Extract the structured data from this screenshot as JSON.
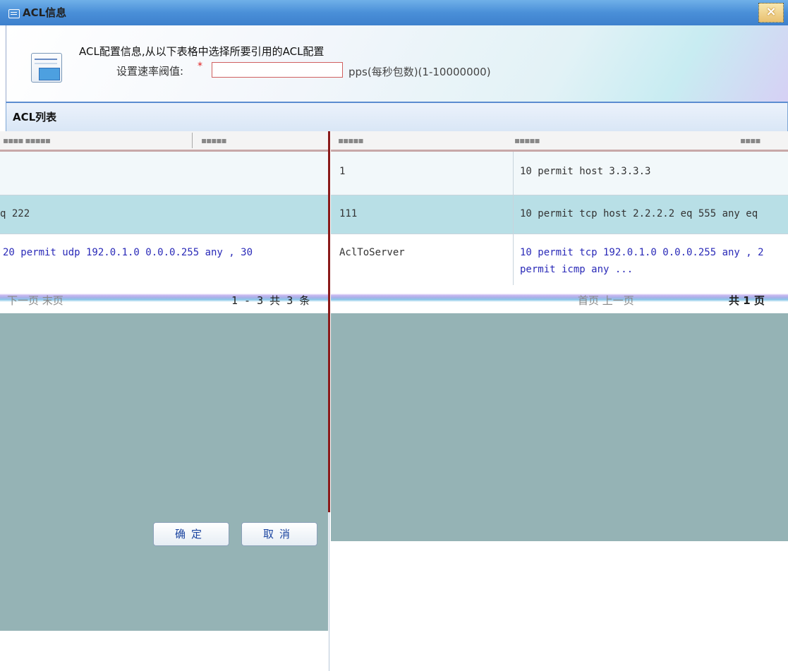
{
  "dialog": {
    "title": "ACL信息",
    "close_label": "×"
  },
  "header": {
    "info_text": "ACL配置信息,从以下表格中选择所要引用的ACL配置",
    "rate_label": "设置速率阀值:",
    "required_mark": "*",
    "rate_value": "",
    "rate_unit": "pps(每秒包数)(1-10000000)"
  },
  "acl_list": {
    "title": "ACL列表"
  },
  "left_table": {
    "header_fragments": [
      "▪▪▪▪ ▪▪▪▪▪",
      "▪▪▪▪▪"
    ],
    "rows": [
      {
        "text": ""
      },
      {
        "text": "q 222"
      },
      {
        "text": "20 permit udp 192.0.1.0 0.0.0.255 any , 30"
      }
    ],
    "pager": {
      "nav_text": "下一页 末页",
      "range_text": "1 - 3  共 3 条"
    },
    "buttons": {
      "ok_label": "确定",
      "cancel_label": "取消"
    }
  },
  "right_table": {
    "header_fragments": [
      "▪▪▪▪▪",
      "▪▪▪▪▪",
      "▪▪▪▪"
    ],
    "rows": [
      {
        "name": "1",
        "rule": "10 permit host 3.3.3.3",
        "rule2": ""
      },
      {
        "name": "111",
        "rule": "10 permit tcp host 2.2.2.2 eq 555 any eq",
        "rule2": ""
      },
      {
        "name": "AclToServer",
        "rule": "10 permit tcp 192.0.1.0 0.0.0.255 any , 2",
        "rule2": "permit icmp any ..."
      }
    ],
    "pager": {
      "nav_text": "首页 上一页",
      "page_value": "1",
      "total_text": "共 1 页"
    }
  },
  "colors": {
    "title_bar": "#4a8fd8",
    "row_highlight": "#b8dfe6",
    "empty_area": "#95b3b5",
    "link_text": "#2a2ab8",
    "divider": "#8a1a1a"
  }
}
